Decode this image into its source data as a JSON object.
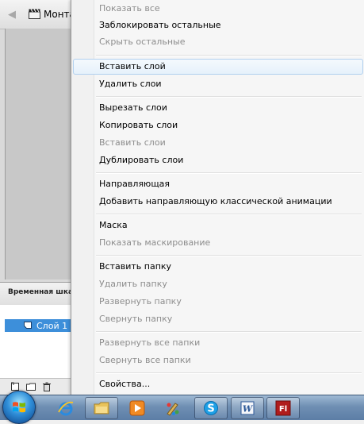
{
  "header": {
    "scene_label": "Монта"
  },
  "timeline": {
    "title": "Временная шкала",
    "layer_name": "Слой 1"
  },
  "context_menu": {
    "items": [
      {
        "label": "Показать все",
        "enabled": false
      },
      {
        "label": "Заблокировать остальные",
        "enabled": true
      },
      {
        "label": "Скрыть остальные",
        "enabled": false
      },
      {
        "label": "Вставить слой",
        "enabled": true,
        "highlighted": true
      },
      {
        "label": "Удалить слои",
        "enabled": true
      },
      {
        "label": "Вырезать слои",
        "enabled": true
      },
      {
        "label": "Копировать слои",
        "enabled": true
      },
      {
        "label": "Вставить слои",
        "enabled": false
      },
      {
        "label": "Дублировать слои",
        "enabled": true
      },
      {
        "label": "Направляющая",
        "enabled": true
      },
      {
        "label": "Добавить направляющую классической анимации",
        "enabled": true
      },
      {
        "label": "Маска",
        "enabled": true
      },
      {
        "label": "Показать маскирование",
        "enabled": false
      },
      {
        "label": "Вставить папку",
        "enabled": true
      },
      {
        "label": "Удалить папку",
        "enabled": false
      },
      {
        "label": "Развернуть папку",
        "enabled": false
      },
      {
        "label": "Свернуть папку",
        "enabled": false
      },
      {
        "label": "Развернуть все папки",
        "enabled": false
      },
      {
        "label": "Свернуть все папки",
        "enabled": false
      },
      {
        "label": "Свойства...",
        "enabled": true
      }
    ]
  },
  "taskbar": {
    "buttons": [
      {
        "name": "internet-explorer",
        "icon": "ie-icon"
      },
      {
        "name": "explorer",
        "icon": "folder-icon"
      },
      {
        "name": "media-player",
        "icon": "media-player-icon"
      },
      {
        "name": "paint",
        "icon": "paint-icon"
      },
      {
        "name": "skype",
        "icon": "skype-icon"
      },
      {
        "name": "word",
        "icon": "word-icon",
        "text": "W"
      },
      {
        "name": "flash",
        "icon": "flash-icon",
        "text": "Fl"
      }
    ]
  },
  "colors": {
    "selection": "#3d8fda",
    "menu_highlight_border": "#b2d1ef",
    "disabled_text": "#8d8d8d",
    "taskbar": "#6f8fb3"
  }
}
